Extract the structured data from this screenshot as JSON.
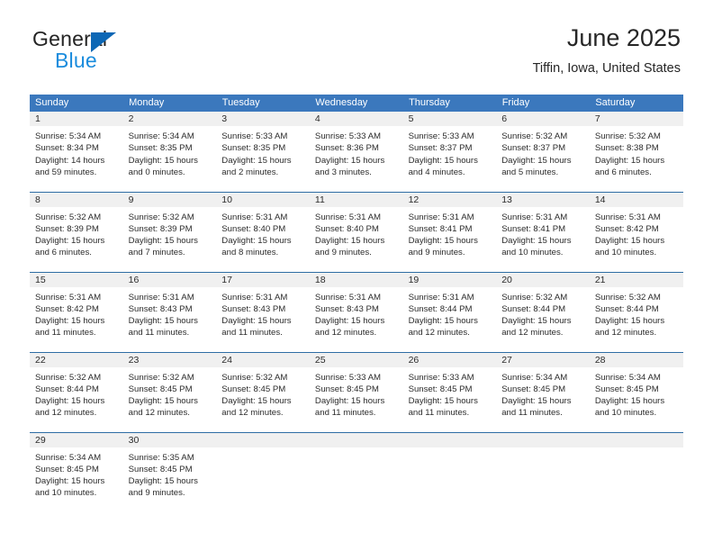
{
  "brand": {
    "name_top": "General",
    "name_bottom": "Blue",
    "accent_color": "#1a8cdd",
    "triangle_color": "#0c67b5"
  },
  "header": {
    "title": "June 2025",
    "subtitle": "Tiffin, Iowa, United States"
  },
  "theme": {
    "header_bg": "#3b78bd",
    "header_text": "#ffffff",
    "daynum_bg": "#f0f0f0",
    "row_divider": "#2e6da4",
    "body_text": "#2b2b2b"
  },
  "calendar": {
    "weekdays": [
      "Sunday",
      "Monday",
      "Tuesday",
      "Wednesday",
      "Thursday",
      "Friday",
      "Saturday"
    ],
    "weeks": [
      [
        {
          "day": "1",
          "sunrise": "Sunrise: 5:34 AM",
          "sunset": "Sunset: 8:34 PM",
          "daylight_line1": "Daylight: 14 hours",
          "daylight_line2": "and 59 minutes."
        },
        {
          "day": "2",
          "sunrise": "Sunrise: 5:34 AM",
          "sunset": "Sunset: 8:35 PM",
          "daylight_line1": "Daylight: 15 hours",
          "daylight_line2": "and 0 minutes."
        },
        {
          "day": "3",
          "sunrise": "Sunrise: 5:33 AM",
          "sunset": "Sunset: 8:35 PM",
          "daylight_line1": "Daylight: 15 hours",
          "daylight_line2": "and 2 minutes."
        },
        {
          "day": "4",
          "sunrise": "Sunrise: 5:33 AM",
          "sunset": "Sunset: 8:36 PM",
          "daylight_line1": "Daylight: 15 hours",
          "daylight_line2": "and 3 minutes."
        },
        {
          "day": "5",
          "sunrise": "Sunrise: 5:33 AM",
          "sunset": "Sunset: 8:37 PM",
          "daylight_line1": "Daylight: 15 hours",
          "daylight_line2": "and 4 minutes."
        },
        {
          "day": "6",
          "sunrise": "Sunrise: 5:32 AM",
          "sunset": "Sunset: 8:37 PM",
          "daylight_line1": "Daylight: 15 hours",
          "daylight_line2": "and 5 minutes."
        },
        {
          "day": "7",
          "sunrise": "Sunrise: 5:32 AM",
          "sunset": "Sunset: 8:38 PM",
          "daylight_line1": "Daylight: 15 hours",
          "daylight_line2": "and 6 minutes."
        }
      ],
      [
        {
          "day": "8",
          "sunrise": "Sunrise: 5:32 AM",
          "sunset": "Sunset: 8:39 PM",
          "daylight_line1": "Daylight: 15 hours",
          "daylight_line2": "and 6 minutes."
        },
        {
          "day": "9",
          "sunrise": "Sunrise: 5:32 AM",
          "sunset": "Sunset: 8:39 PM",
          "daylight_line1": "Daylight: 15 hours",
          "daylight_line2": "and 7 minutes."
        },
        {
          "day": "10",
          "sunrise": "Sunrise: 5:31 AM",
          "sunset": "Sunset: 8:40 PM",
          "daylight_line1": "Daylight: 15 hours",
          "daylight_line2": "and 8 minutes."
        },
        {
          "day": "11",
          "sunrise": "Sunrise: 5:31 AM",
          "sunset": "Sunset: 8:40 PM",
          "daylight_line1": "Daylight: 15 hours",
          "daylight_line2": "and 9 minutes."
        },
        {
          "day": "12",
          "sunrise": "Sunrise: 5:31 AM",
          "sunset": "Sunset: 8:41 PM",
          "daylight_line1": "Daylight: 15 hours",
          "daylight_line2": "and 9 minutes."
        },
        {
          "day": "13",
          "sunrise": "Sunrise: 5:31 AM",
          "sunset": "Sunset: 8:41 PM",
          "daylight_line1": "Daylight: 15 hours",
          "daylight_line2": "and 10 minutes."
        },
        {
          "day": "14",
          "sunrise": "Sunrise: 5:31 AM",
          "sunset": "Sunset: 8:42 PM",
          "daylight_line1": "Daylight: 15 hours",
          "daylight_line2": "and 10 minutes."
        }
      ],
      [
        {
          "day": "15",
          "sunrise": "Sunrise: 5:31 AM",
          "sunset": "Sunset: 8:42 PM",
          "daylight_line1": "Daylight: 15 hours",
          "daylight_line2": "and 11 minutes."
        },
        {
          "day": "16",
          "sunrise": "Sunrise: 5:31 AM",
          "sunset": "Sunset: 8:43 PM",
          "daylight_line1": "Daylight: 15 hours",
          "daylight_line2": "and 11 minutes."
        },
        {
          "day": "17",
          "sunrise": "Sunrise: 5:31 AM",
          "sunset": "Sunset: 8:43 PM",
          "daylight_line1": "Daylight: 15 hours",
          "daylight_line2": "and 11 minutes."
        },
        {
          "day": "18",
          "sunrise": "Sunrise: 5:31 AM",
          "sunset": "Sunset: 8:43 PM",
          "daylight_line1": "Daylight: 15 hours",
          "daylight_line2": "and 12 minutes."
        },
        {
          "day": "19",
          "sunrise": "Sunrise: 5:31 AM",
          "sunset": "Sunset: 8:44 PM",
          "daylight_line1": "Daylight: 15 hours",
          "daylight_line2": "and 12 minutes."
        },
        {
          "day": "20",
          "sunrise": "Sunrise: 5:32 AM",
          "sunset": "Sunset: 8:44 PM",
          "daylight_line1": "Daylight: 15 hours",
          "daylight_line2": "and 12 minutes."
        },
        {
          "day": "21",
          "sunrise": "Sunrise: 5:32 AM",
          "sunset": "Sunset: 8:44 PM",
          "daylight_line1": "Daylight: 15 hours",
          "daylight_line2": "and 12 minutes."
        }
      ],
      [
        {
          "day": "22",
          "sunrise": "Sunrise: 5:32 AM",
          "sunset": "Sunset: 8:44 PM",
          "daylight_line1": "Daylight: 15 hours",
          "daylight_line2": "and 12 minutes."
        },
        {
          "day": "23",
          "sunrise": "Sunrise: 5:32 AM",
          "sunset": "Sunset: 8:45 PM",
          "daylight_line1": "Daylight: 15 hours",
          "daylight_line2": "and 12 minutes."
        },
        {
          "day": "24",
          "sunrise": "Sunrise: 5:32 AM",
          "sunset": "Sunset: 8:45 PM",
          "daylight_line1": "Daylight: 15 hours",
          "daylight_line2": "and 12 minutes."
        },
        {
          "day": "25",
          "sunrise": "Sunrise: 5:33 AM",
          "sunset": "Sunset: 8:45 PM",
          "daylight_line1": "Daylight: 15 hours",
          "daylight_line2": "and 11 minutes."
        },
        {
          "day": "26",
          "sunrise": "Sunrise: 5:33 AM",
          "sunset": "Sunset: 8:45 PM",
          "daylight_line1": "Daylight: 15 hours",
          "daylight_line2": "and 11 minutes."
        },
        {
          "day": "27",
          "sunrise": "Sunrise: 5:34 AM",
          "sunset": "Sunset: 8:45 PM",
          "daylight_line1": "Daylight: 15 hours",
          "daylight_line2": "and 11 minutes."
        },
        {
          "day": "28",
          "sunrise": "Sunrise: 5:34 AM",
          "sunset": "Sunset: 8:45 PM",
          "daylight_line1": "Daylight: 15 hours",
          "daylight_line2": "and 10 minutes."
        }
      ],
      [
        {
          "day": "29",
          "sunrise": "Sunrise: 5:34 AM",
          "sunset": "Sunset: 8:45 PM",
          "daylight_line1": "Daylight: 15 hours",
          "daylight_line2": "and 10 minutes."
        },
        {
          "day": "30",
          "sunrise": "Sunrise: 5:35 AM",
          "sunset": "Sunset: 8:45 PM",
          "daylight_line1": "Daylight: 15 hours",
          "daylight_line2": "and 9 minutes."
        },
        {
          "day": "",
          "sunrise": "",
          "sunset": "",
          "daylight_line1": "",
          "daylight_line2": ""
        },
        {
          "day": "",
          "sunrise": "",
          "sunset": "",
          "daylight_line1": "",
          "daylight_line2": ""
        },
        {
          "day": "",
          "sunrise": "",
          "sunset": "",
          "daylight_line1": "",
          "daylight_line2": ""
        },
        {
          "day": "",
          "sunrise": "",
          "sunset": "",
          "daylight_line1": "",
          "daylight_line2": ""
        },
        {
          "day": "",
          "sunrise": "",
          "sunset": "",
          "daylight_line1": "",
          "daylight_line2": ""
        }
      ]
    ]
  }
}
